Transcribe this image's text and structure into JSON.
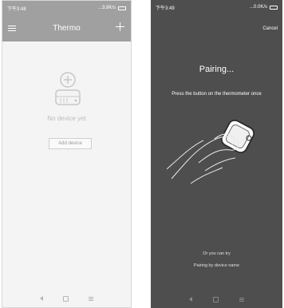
{
  "left_screen": {
    "status": {
      "time": "下午3:48",
      "net": "...3.8K/s"
    },
    "header": {
      "title": "Thermo",
      "menu_icon": "menu-icon",
      "add_icon": "plus-icon"
    },
    "empty_state": {
      "icon": "thermometer-device-icon",
      "text": "No device yet",
      "add_button": "Add device"
    },
    "navbar": {
      "back_icon": "back-icon",
      "home_icon": "home-icon",
      "menu_icon": "recents-icon"
    }
  },
  "right_screen": {
    "status": {
      "time": "下午3:49",
      "net": "...0.0K/s"
    },
    "cancel": "Cancel",
    "title": "Pairing...",
    "instruction": "Press the button on the thermometer once",
    "illustration": "hand-pressing-thermometer-icon",
    "alt_prefix": "Or you can try",
    "alt_link": "Pairing by device name",
    "navbar": {
      "back_icon": "back-icon",
      "home_icon": "home-icon",
      "menu_icon": "recents-icon"
    }
  },
  "colors": {
    "header": "#a0a0a0",
    "background_left": "#f4f4f4",
    "background_right": "#4e4e4e"
  }
}
